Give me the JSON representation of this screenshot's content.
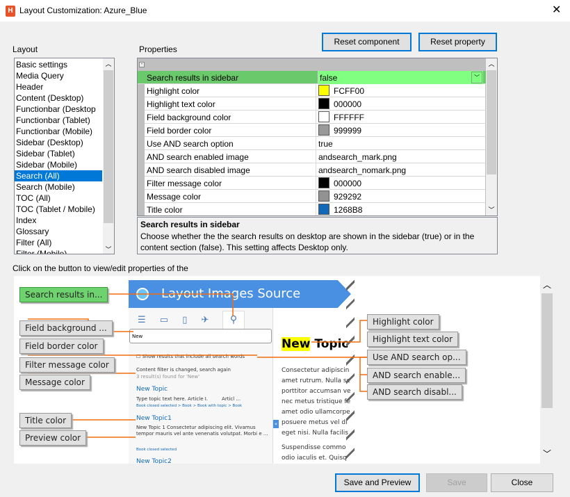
{
  "window": {
    "title": "Layout Customization: Azure_Blue",
    "close": "✕"
  },
  "layout": {
    "label": "Layout",
    "items": [
      "Basic settings",
      "Media Query",
      "Header",
      "Content (Desktop)",
      "Functionbar (Desktop",
      "Functionbar (Tablet)",
      "Functionbar (Mobile)",
      "Sidebar (Desktop)",
      "Sidebar (Tablet)",
      "Sidebar (Mobile)",
      "Search (All)",
      "Search (Mobile)",
      "TOC (All)",
      "TOC (Tablet / Mobile)",
      "Index",
      "Glossary",
      "Filter (All)",
      "Filter (Mobile)"
    ],
    "selected": "Search (All)"
  },
  "toolbar": {
    "reset_component": "Reset component",
    "reset_property": "Reset property"
  },
  "properties": {
    "label": "Properties",
    "rows": [
      {
        "name": "Search results in sidebar",
        "value": "false",
        "selected": true
      },
      {
        "name": "Highlight color",
        "value": "FCFF00",
        "swatch": "#FCFF00"
      },
      {
        "name": "Highlight text color",
        "value": "000000",
        "swatch": "#000000"
      },
      {
        "name": "Field background color",
        "value": "FFFFFF",
        "swatch": "#FFFFFF"
      },
      {
        "name": "Field border color",
        "value": "999999",
        "swatch": "#999999"
      },
      {
        "name": "Use AND search option",
        "value": "true"
      },
      {
        "name": "AND search enabled image",
        "value": "andsearch_mark.png"
      },
      {
        "name": "AND search disabled image",
        "value": "andsearch_nomark.png"
      },
      {
        "name": "Filter message color",
        "value": "000000",
        "swatch": "#000000"
      },
      {
        "name": "Message color",
        "value": "929292",
        "swatch": "#929292"
      },
      {
        "name": "Title color",
        "value": "1268B8",
        "swatch": "#1268B8"
      }
    ]
  },
  "description": {
    "title": "Search results in sidebar",
    "text": "Choose whether the the search results on desktop are shown in the sidebar (true) or in the content section (false). This setting affects Desktop only."
  },
  "hint": "Click on the button to view/edit properties of the",
  "preview": {
    "left_buttons": [
      "Search results in...",
      "Field background ...",
      "Field border color",
      "Filter message color",
      "Message color",
      "Title color",
      "Preview color"
    ],
    "right_buttons": [
      "Highlight color",
      "Highlight text color",
      "Use AND search op...",
      "AND search enable...",
      "AND search disabl..."
    ],
    "mock": {
      "banner": "Layout Images Source",
      "search_value": "New",
      "and_option": "Show results that include all search words",
      "filter_msg": "Content filter is changed, search again",
      "result_msg": "3 result(s) found for 'New'",
      "results": [
        {
          "title": "New Topic",
          "text": "Type topic text here. Article I.         Articl ...",
          "crumb": "Book closed selected > Book > Book with topic > Book"
        },
        {
          "title": "New Topic1",
          "text": "New Topic 1 Consectetur adipiscing elit. Vivamus tempor mauris vel ante venenatis volutpat. Morbi e ...",
          "crumb": "Book closed selected"
        },
        {
          "title": "New Topic2"
        }
      ],
      "topic_highlight": "New",
      "topic_rest": " Topic",
      "body1": [
        "Consectetur adipiscin",
        "amet rutrum. Nulla se",
        "porttitor accumsan ve",
        "nec metus tristique fe",
        "amet odio ullamcorpe",
        "posuere metus vel di",
        "eget nisi. Nulla facilis"
      ],
      "body2": [
        "Suspendisse commo",
        "odio iaculis et. Quisq"
      ],
      "highlight_color": "#FCFF00",
      "accent": "#4a90e2"
    }
  },
  "footer": {
    "save_preview": "Save and Preview",
    "save": "Save",
    "close": "Close"
  }
}
